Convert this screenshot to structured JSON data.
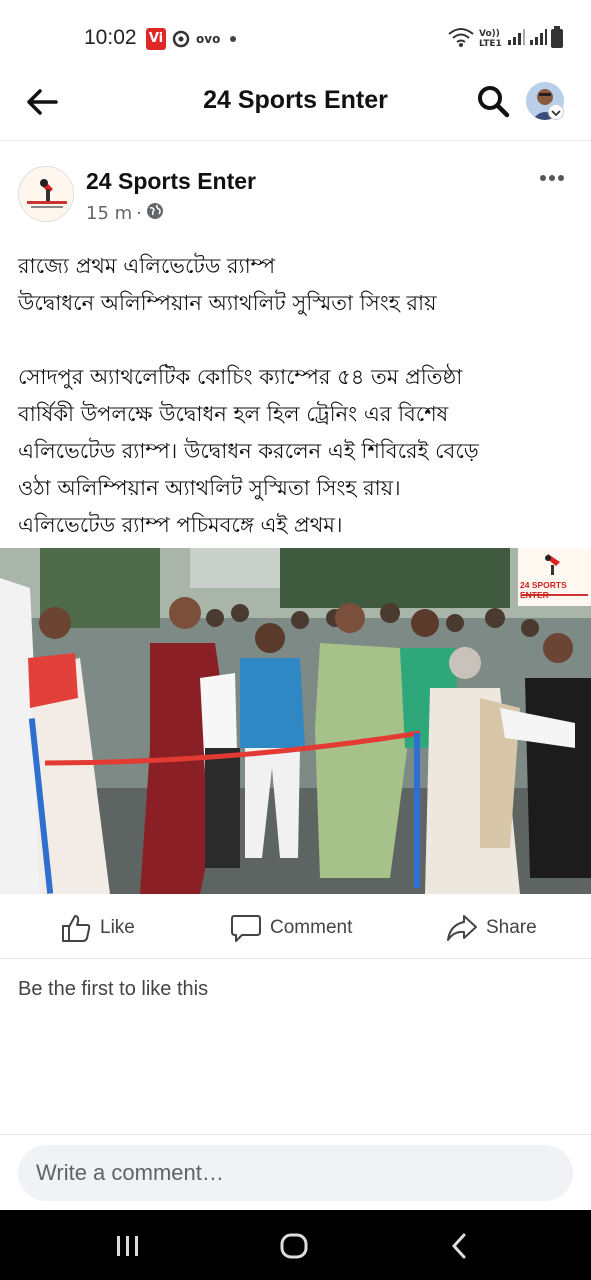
{
  "status_bar": {
    "time": "10:02",
    "carrier_badge": "Vi",
    "app_text": "ovo",
    "network_label": "Vo)) LTE1"
  },
  "header": {
    "title": "24 Sports Enter"
  },
  "post": {
    "page_name": "24 Sports Enter",
    "time": "15 m",
    "paragraph1": [
      "রাজ্যে প্রথম এলিভেটেড র‍্যাম্প",
      "উদ্বোধনে অলিম্পিয়ান অ্যাথলিট সুস্মিতা সিংহ রায়"
    ],
    "paragraph2": [
      "সোদপুর অ্যাথলেটিক কোচিং ক্যাম্পের ৫৪ তম প্রতিষ্ঠা",
      "বার্ষিকী উপলক্ষে উদ্বোধন হল হিল ট্রেনিং এর বিশেষ",
      "এলিভেটেড র‍্যাম্প। উদ্বোধন করলেন এই শিবিরেই বেড়ে",
      "ওঠা অলিম্পিয়ান অ্যাথলিট  সুস্মিতা সিংহ রায়।",
      "এলিভেটেড র‍্যাম্প পচিমবঙ্গে এই প্রথম।"
    ],
    "photo_watermark": "24 SPORTS ENTER"
  },
  "actions": {
    "like": "Like",
    "comment": "Comment",
    "share": "Share"
  },
  "reactions_text": "Be the first to like this",
  "comment_box": {
    "placeholder": "Write a comment…"
  },
  "colors": {
    "accent": "#1877f2",
    "text": "#050505",
    "secondary": "#65676b",
    "divider": "#e4e6eb"
  }
}
